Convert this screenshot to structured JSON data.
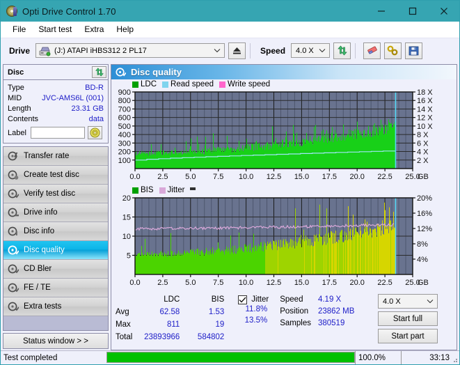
{
  "window": {
    "title": "Opti Drive Control 1.70",
    "app_icon": "disc-icon",
    "minimize": "minimize-icon",
    "maximize": "maximize-icon",
    "close": "close-icon"
  },
  "menu": {
    "items": [
      {
        "label": "File"
      },
      {
        "label": "Start test"
      },
      {
        "label": "Extra"
      },
      {
        "label": "Help"
      }
    ]
  },
  "toolbar": {
    "drive_label": "Drive",
    "drive_value": "(J:)   ATAPI iHBS312   2 PL17",
    "eject_icon": "eject-icon",
    "speed_label": "Speed",
    "speed_value": "4.0 X",
    "refresh_icon": "refresh-icon",
    "eraser_icon": "eraser-icon",
    "tools_icon": "tools-icon",
    "save_icon": "save-icon"
  },
  "sidebar": {
    "disc_panel": {
      "title": "Disc",
      "refresh_icon": "refresh-icon",
      "rows": [
        {
          "key": "Type",
          "value": "BD-R"
        },
        {
          "key": "MID",
          "value": "JVC-AMS6L (001)"
        },
        {
          "key": "Length",
          "value": "23.31 GB"
        },
        {
          "key": "Contents",
          "value": "data"
        }
      ],
      "label_key": "Label",
      "label_value": "",
      "label_placeholder": "",
      "label_button_icon": "disc-icon"
    },
    "nav": [
      {
        "label": "Transfer rate",
        "icon": "disc-transfer-icon",
        "active": false
      },
      {
        "label": "Create test disc",
        "icon": "disc-create-icon",
        "active": false
      },
      {
        "label": "Verify test disc",
        "icon": "disc-verify-icon",
        "active": false
      },
      {
        "label": "Drive info",
        "icon": "drive-info-icon",
        "active": false
      },
      {
        "label": "Disc info",
        "icon": "disc-info-icon",
        "active": false
      },
      {
        "label": "Disc quality",
        "icon": "disc-quality-icon",
        "active": true
      },
      {
        "label": "CD Bler",
        "icon": "cd-bler-icon",
        "active": false
      },
      {
        "label": "FE / TE",
        "icon": "fe-te-icon",
        "active": false
      },
      {
        "label": "Extra tests",
        "icon": "extra-tests-icon",
        "active": false
      }
    ],
    "status_window_button": "Status window > >"
  },
  "main": {
    "header_title": "Disc quality",
    "header_icon": "disc-quality-icon"
  },
  "stats": {
    "col_headers": [
      "LDC",
      "BIS"
    ],
    "rows": [
      {
        "key": "Avg",
        "ldc": "62.58",
        "bis": "1.53",
        "jitter": "11.8%"
      },
      {
        "key": "Max",
        "ldc": "811",
        "bis": "19",
        "jitter": "13.5%"
      },
      {
        "key": "Total",
        "ldc": "23893966",
        "bis": "584802",
        "jitter": ""
      }
    ],
    "jitter_label": "Jitter",
    "jitter_checked": true,
    "speed_label": "Speed",
    "speed_value": "4.19 X",
    "position_label": "Position",
    "position_value": "23862 MB",
    "samples_label": "Samples",
    "samples_value": "380519",
    "speed_select": "4.0 X",
    "start_full_button": "Start full",
    "start_part_button": "Start part"
  },
  "statusbar": {
    "message": "Test completed",
    "progress_percent_label": "100.0%",
    "progress_value": 100,
    "elapsed_time": "33:13"
  },
  "colors": {
    "title_bar": "#36a5b2",
    "accent_blue": "#2020c8",
    "ldc_green": "#00c000",
    "bis_green": "#4bd400",
    "jitter_pink": "#d9a8d9",
    "read_speed": "#7fd4ee",
    "write_speed": "#ff66cc",
    "plot_bg": "#69738f",
    "yellow": "#cfcf00",
    "progress_green": "#00c000"
  },
  "chart_data": [
    {
      "type": "area",
      "name": "disc-quality-ldc-chart",
      "title": "",
      "xlabel": "GB",
      "ylabel": "",
      "xlim": [
        0,
        25
      ],
      "ylim": [
        0,
        900
      ],
      "y2lim": [
        0,
        18
      ],
      "xticks": [
        "0.0",
        "2.5",
        "5.0",
        "7.5",
        "10.0",
        "12.5",
        "15.0",
        "17.5",
        "20.0",
        "22.5",
        "25.0"
      ],
      "yticks": [
        100,
        200,
        300,
        400,
        500,
        600,
        700,
        800,
        900
      ],
      "y2ticks": [
        "2 X",
        "4 X",
        "6 X",
        "8 X",
        "10 X",
        "12 X",
        "14 X",
        "16 X",
        "18 X"
      ],
      "grid": true,
      "legend": [
        {
          "label": "LDC",
          "color": "#00a000"
        },
        {
          "label": "Read speed",
          "color": "#7fd4ee"
        },
        {
          "label": "Write speed",
          "color": "#ff66cc"
        }
      ],
      "series": [
        {
          "name": "LDC",
          "color": "#18d018",
          "kind": "bars",
          "baseline_start": 170,
          "baseline_end": 470,
          "noise": 110,
          "spike_rate": 0.09,
          "spike_max": 560,
          "x_end": 23.4
        },
        {
          "name": "Read speed",
          "color": "#9fe6f6",
          "kind": "line",
          "y2_start": 2.0,
          "y2_end": 4.2,
          "steps": 22,
          "x_end": 23.4
        }
      ]
    },
    {
      "type": "area",
      "name": "disc-quality-bis-chart",
      "title": "",
      "xlabel": "GB",
      "ylabel": "",
      "xlim": [
        0,
        25
      ],
      "ylim": [
        0,
        20
      ],
      "y2lim": [
        0,
        20
      ],
      "xticks": [
        "0.0",
        "2.5",
        "5.0",
        "7.5",
        "10.0",
        "12.5",
        "15.0",
        "17.5",
        "20.0",
        "22.5",
        "25.0"
      ],
      "yticks": [
        5,
        10,
        15,
        20
      ],
      "y2ticks": [
        "4%",
        "8%",
        "12%",
        "16%",
        "20%"
      ],
      "grid": true,
      "legend": [
        {
          "label": "BIS",
          "color": "#00a000"
        },
        {
          "label": "Jitter",
          "color": "#d9a8d9"
        }
      ],
      "series": [
        {
          "name": "BIS",
          "color": "#4bd400",
          "kind": "bars",
          "baseline_start": 5.0,
          "baseline_end": 12.0,
          "noise": 3.0,
          "spike_rate": 0.06,
          "spike_max": 19,
          "x_end": 23.4
        },
        {
          "name": "Jitter",
          "color": "#d9a8d9",
          "kind": "line",
          "y_start": 11.9,
          "y_end": 13.0,
          "noise": 0.35,
          "x_end": 23.4
        }
      ]
    }
  ]
}
